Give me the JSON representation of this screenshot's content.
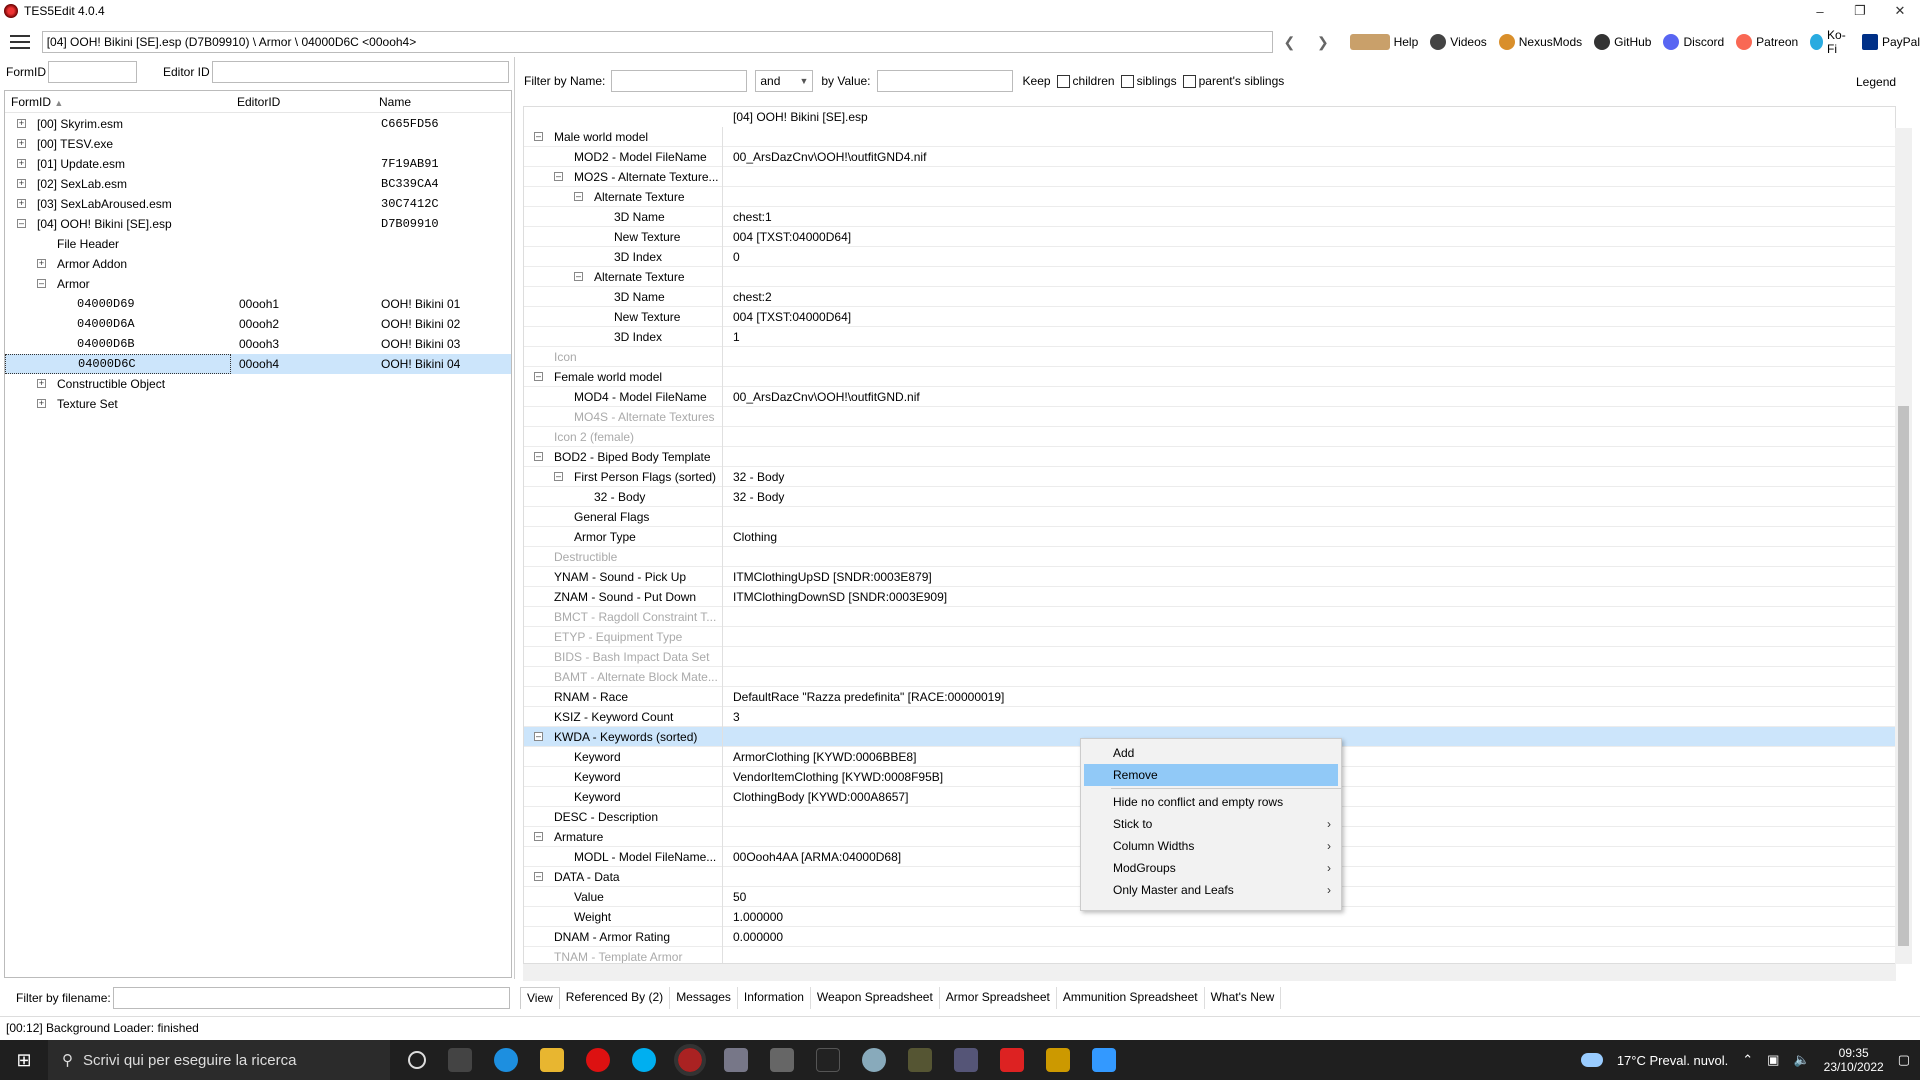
{
  "window": {
    "title": "TES5Edit 4.0.4"
  },
  "path_bar": {
    "text": "[04] OOH! Bikini [SE].esp (D7B09910) \\ Armor \\ 04000D6C <00ooh4>"
  },
  "toolbar": {
    "help": "Help",
    "videos": "Videos",
    "nexusmods": "NexusMods",
    "github": "GitHub",
    "discord": "Discord",
    "patreon": "Patreon",
    "kofi": "Ko-Fi",
    "paypal": "PayPal"
  },
  "left": {
    "formid_label": "FormID",
    "editorid_label": "Editor ID",
    "columns": {
      "formid": "FormID",
      "editorid": "EditorID",
      "name": "Name"
    },
    "filter_label": "Filter by filename:"
  },
  "tree": [
    {
      "label": "[00] Skyrim.esm",
      "name": "C665FD56"
    },
    {
      "label": "[00] TESV.exe",
      "name": ""
    },
    {
      "label": "[01] Update.esm",
      "name": "7F19AB91"
    },
    {
      "label": "[02] SexLab.esm",
      "name": "BC339CA4"
    },
    {
      "label": "[03] SexLabAroused.esm",
      "name": "30C7412C"
    },
    {
      "label": "[04] OOH! Bikini [SE].esp",
      "name": "D7B09910"
    },
    {
      "label": "File Header"
    },
    {
      "label": "Armor Addon"
    },
    {
      "label": "Armor"
    },
    {
      "label": "04000D69",
      "editorid": "00ooh1",
      "name": "OOH! Bikini 01"
    },
    {
      "label": "04000D6A",
      "editorid": "00ooh2",
      "name": "OOH! Bikini 02"
    },
    {
      "label": "04000D6B",
      "editorid": "00ooh3",
      "name": "OOH! Bikini 03"
    },
    {
      "label": "04000D6C",
      "editorid": "00ooh4",
      "name": "OOH! Bikini 04"
    },
    {
      "label": "Constructible Object"
    },
    {
      "label": "Texture Set"
    }
  ],
  "filter": {
    "by_name": "Filter by Name:",
    "and": "and",
    "by_value": "by Value:",
    "keep": "Keep",
    "children": "children",
    "siblings": "siblings",
    "parents_siblings": "parent's siblings",
    "legend": "Legend"
  },
  "grid": {
    "header_value": "[04] OOH! Bikini [SE].esp",
    "rows": [
      {
        "label": "Male world model",
        "value": ""
      },
      {
        "label": "MOD2 - Model FileName",
        "value": "00_ArsDazCnv\\OOH!\\outfitGND4.nif"
      },
      {
        "label": "MO2S - Alternate Texture...",
        "value": ""
      },
      {
        "label": "Alternate Texture",
        "value": ""
      },
      {
        "label": "3D Name",
        "value": "chest:1"
      },
      {
        "label": "New Texture",
        "value": "004 [TXST:04000D64]"
      },
      {
        "label": "3D Index",
        "value": "0"
      },
      {
        "label": "Alternate Texture",
        "value": ""
      },
      {
        "label": "3D Name",
        "value": "chest:2"
      },
      {
        "label": "New Texture",
        "value": "004 [TXST:04000D64]"
      },
      {
        "label": "3D Index",
        "value": "1"
      },
      {
        "label": "Icon",
        "value": ""
      },
      {
        "label": "Female world model",
        "value": ""
      },
      {
        "label": "MOD4 - Model FileName",
        "value": "00_ArsDazCnv\\OOH!\\outfitGND.nif"
      },
      {
        "label": "MO4S - Alternate Textures",
        "value": ""
      },
      {
        "label": "Icon 2 (female)",
        "value": ""
      },
      {
        "label": "BOD2 - Biped Body Template",
        "value": ""
      },
      {
        "label": "First Person Flags (sorted)",
        "value": "32 - Body"
      },
      {
        "label": "32 - Body",
        "value": "32 - Body"
      },
      {
        "label": "General Flags",
        "value": ""
      },
      {
        "label": "Armor Type",
        "value": "Clothing"
      },
      {
        "label": "Destructible",
        "value": ""
      },
      {
        "label": "YNAM - Sound - Pick Up",
        "value": "ITMClothingUpSD [SNDR:0003E879]"
      },
      {
        "label": "ZNAM - Sound - Put Down",
        "value": "ITMClothingDownSD [SNDR:0003E909]"
      },
      {
        "label": "BMCT - Ragdoll Constraint T...",
        "value": ""
      },
      {
        "label": "ETYP - Equipment Type",
        "value": ""
      },
      {
        "label": "BIDS - Bash Impact Data Set",
        "value": ""
      },
      {
        "label": "BAMT - Alternate Block Mate...",
        "value": ""
      },
      {
        "label": "RNAM - Race",
        "value": "DefaultRace \"Razza predefinita\" [RACE:00000019]"
      },
      {
        "label": "KSIZ - Keyword Count",
        "value": "3"
      },
      {
        "label": "KWDA - Keywords (sorted)",
        "value": ""
      },
      {
        "label": "Keyword",
        "value": "ArmorClothing [KYWD:0006BBE8]"
      },
      {
        "label": "Keyword",
        "value": "VendorItemClothing [KYWD:0008F95B]"
      },
      {
        "label": "Keyword",
        "value": "ClothingBody [KYWD:000A8657]"
      },
      {
        "label": "DESC - Description",
        "value": ""
      },
      {
        "label": "Armature",
        "value": ""
      },
      {
        "label": "MODL - Model FileName...",
        "value": "00Oooh4AA [ARMA:04000D68]"
      },
      {
        "label": "DATA - Data",
        "value": ""
      },
      {
        "label": "Value",
        "value": "50"
      },
      {
        "label": "Weight",
        "value": "1.000000"
      },
      {
        "label": "DNAM - Armor Rating",
        "value": "0.000000"
      },
      {
        "label": "TNAM - Template Armor",
        "value": ""
      }
    ]
  },
  "context_menu": {
    "add": "Add",
    "remove": "Remove",
    "hide": "Hide no conflict and empty rows",
    "stick": "Stick to",
    "col_widths": "Column Widths",
    "modgroups": "ModGroups",
    "only_master": "Only Master and Leafs"
  },
  "tabs": [
    "View",
    "Referenced By (2)",
    "Messages",
    "Information",
    "Weapon Spreadsheet",
    "Armor Spreadsheet",
    "Ammunition Spreadsheet",
    "What's New"
  ],
  "status": "[00:12] Background Loader: finished",
  "taskbar": {
    "search": "Scrivi qui per eseguire la ricerca",
    "weather": "17°C  Preval. nuvol.",
    "time": "09:35",
    "date": "23/10/2022"
  }
}
